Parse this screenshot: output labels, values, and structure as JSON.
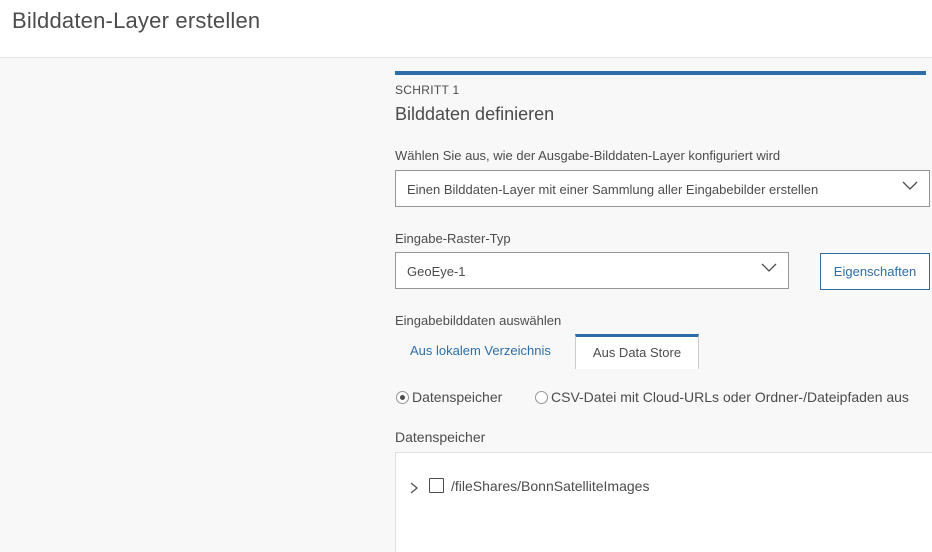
{
  "page": {
    "title": "Bilddaten-Layer erstellen"
  },
  "step": {
    "label": "SCHRITT 1",
    "title": "Bilddaten definieren"
  },
  "config": {
    "label": "Wählen Sie aus, wie der Ausgabe-Bilddaten-Layer konfiguriert wird",
    "selected": "Einen Bilddaten-Layer mit einer Sammlung aller Eingabebilder erstellen"
  },
  "raster_type": {
    "label": "Eingabe-Raster-Typ",
    "selected": "GeoEye-1",
    "properties_button": "Eigenschaften"
  },
  "input_imagery": {
    "label": "Eingabebilddaten auswählen",
    "tabs": [
      {
        "label": "Aus lokalem Verzeichnis",
        "active": false
      },
      {
        "label": "Aus Data Store",
        "active": true
      }
    ]
  },
  "source_options": [
    {
      "label": "Datenspeicher",
      "checked": true
    },
    {
      "label": "CSV-Datei mit Cloud-URLs oder Ordner-/Dateipfaden aus",
      "checked": false
    }
  ],
  "datastore": {
    "label": "Datenspeicher",
    "items": [
      {
        "path": "/fileShares/BonnSatelliteImages",
        "checked": false,
        "expanded": false
      }
    ]
  },
  "colors": {
    "accent": "#2e6ea6",
    "text": "#4c4c4c",
    "background": "#f8f8f8"
  },
  "icons": {
    "select_chevron": "chevron-down-icon",
    "tree_chevron": "chevron-right-icon"
  }
}
